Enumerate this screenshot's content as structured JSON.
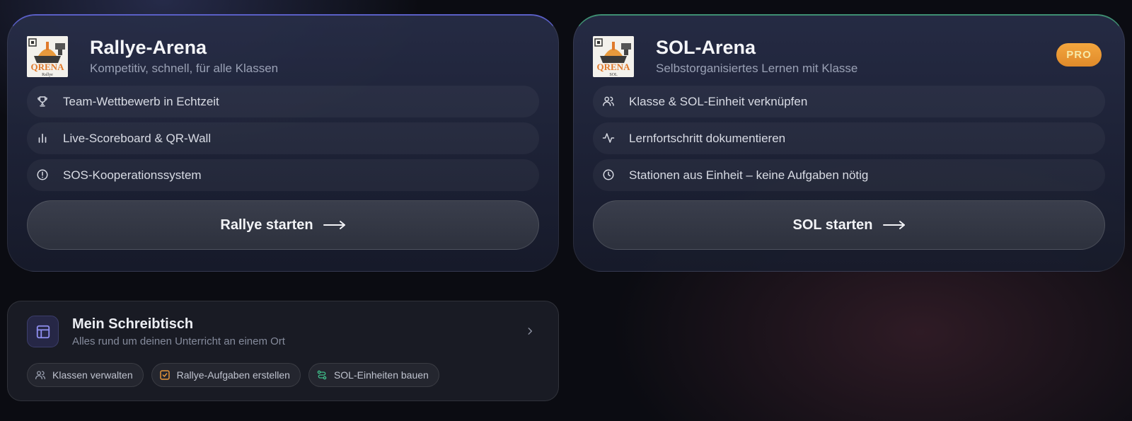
{
  "rallye": {
    "title": "Rallye-Arena",
    "subtitle": "Kompetitiv, schnell, für alle Klassen",
    "logo_text": "QRENA",
    "logo_caption": "Rallye",
    "features": [
      {
        "icon": "trophy-icon",
        "label": "Team-Wettbewerb in Echtzeit"
      },
      {
        "icon": "bar-chart-icon",
        "label": "Live-Scoreboard & QR-Wall"
      },
      {
        "icon": "alert-circle-icon",
        "label": "SOS-Kooperationssystem"
      }
    ],
    "button_label": "Rallye starten",
    "accent": "#5a5fc6"
  },
  "sol": {
    "title": "SOL-Arena",
    "subtitle": "Selbstorganisiertes Lernen mit Klasse",
    "logo_text": "QRENA",
    "logo_caption": "SOL",
    "badge": "PRO",
    "features": [
      {
        "icon": "users-icon",
        "label": "Klasse & SOL-Einheit verknüpfen"
      },
      {
        "icon": "activity-icon",
        "label": "Lernfortschritt dokumentieren"
      },
      {
        "icon": "clock-icon",
        "label": "Stationen aus Einheit – keine Aufgaben nötig"
      }
    ],
    "button_label": "SOL starten",
    "accent": "#3f8f72"
  },
  "desk": {
    "title": "Mein Schreibtisch",
    "subtitle": "Alles rund um deinen Unterricht an einem Ort",
    "chips": [
      {
        "icon": "users-icon",
        "label": "Klassen verwalten",
        "color": "#9aa0b0"
      },
      {
        "icon": "checkbox-icon",
        "label": "Rallye-Aufgaben erstellen",
        "color": "#e8973a"
      },
      {
        "icon": "route-icon",
        "label": "SOL-Einheiten bauen",
        "color": "#3fbf8a"
      }
    ]
  }
}
